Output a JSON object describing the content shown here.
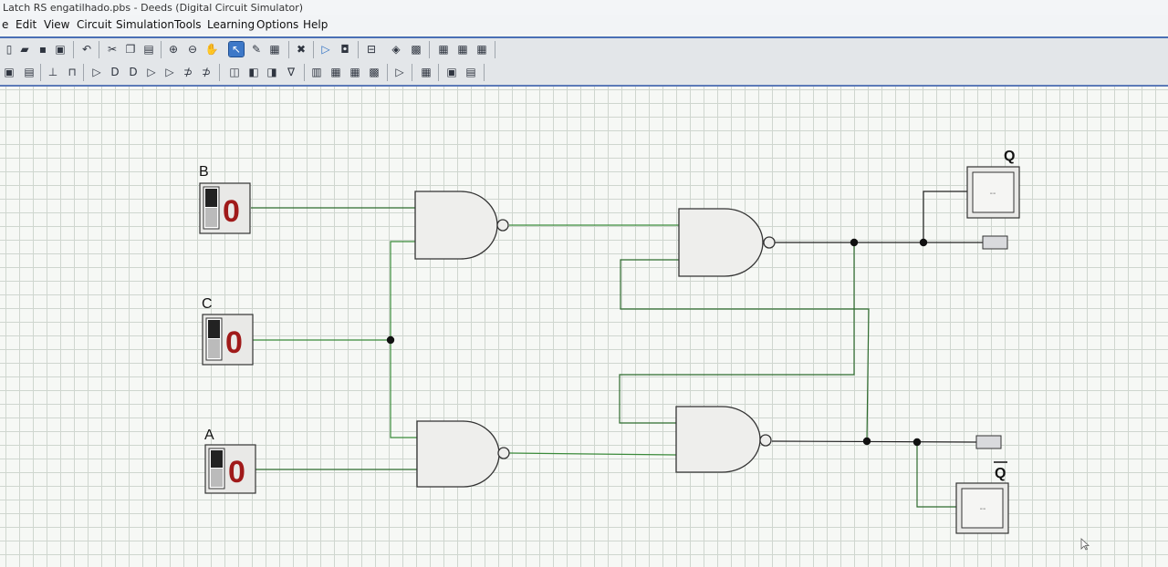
{
  "window": {
    "title": "Latch RS engatilhado.pbs - Deeds (Digital Circuit Simulator)"
  },
  "menu": [
    "e",
    "Edit",
    "View",
    "Circuit",
    "Simulation",
    "Tools",
    "Learning",
    "Options",
    "Help"
  ],
  "toolbar1": {
    "icons": [
      "new-file-icon",
      "open-file-icon",
      "save-icon",
      "save-as-icon",
      "print-icon",
      "undo-icon",
      "cut-icon",
      "copy-icon",
      "paste-icon",
      "zoom-in-icon",
      "zoom-out-icon",
      "pan-hand-icon",
      "select-arrow-icon",
      "pencil-wire-icon",
      "component-icon",
      "delete-icon",
      "start-simulation-icon",
      "stop-simulation-icon",
      "timing-diagram-icon",
      "fsm-icon",
      "ram-icon",
      "chip-1-icon",
      "chip-2-icon",
      "chip-3-icon"
    ],
    "active": "select-arrow-icon"
  },
  "toolbar2": {
    "icons": [
      "input-switch-icon",
      "output-led-icon",
      "ground-icon",
      "clock-icon",
      "buffer-icon",
      "and-gate-icon",
      "nand-gate-icon",
      "or-gate-icon",
      "nor-gate-icon",
      "xor-gate-icon",
      "xnor-gate-icon",
      "flipflop-d-icon",
      "flipflop-jk-icon",
      "flipflop-t-icon",
      "mux-icon",
      "counter-icon",
      "register-icon",
      "decoder-icon",
      "display-icon",
      "probe-icon",
      "memory-icon",
      "component-lib-icon",
      "bus-icon"
    ]
  },
  "circuit": {
    "inputs": [
      {
        "label": "B",
        "value": "0"
      },
      {
        "label": "C",
        "value": "0"
      },
      {
        "label": "A",
        "value": "0"
      }
    ],
    "outputs": [
      {
        "label": "Q",
        "display": "--"
      },
      {
        "label": "Q",
        "display": "--",
        "overline": true
      }
    ],
    "gates": [
      "NAND",
      "NAND",
      "NAND",
      "NAND"
    ],
    "colors": {
      "wire_green": "#3a8a3a",
      "wire_dark": "#222222",
      "digit_red": "#a01a1a",
      "select_blue": "#3d78c8"
    }
  }
}
